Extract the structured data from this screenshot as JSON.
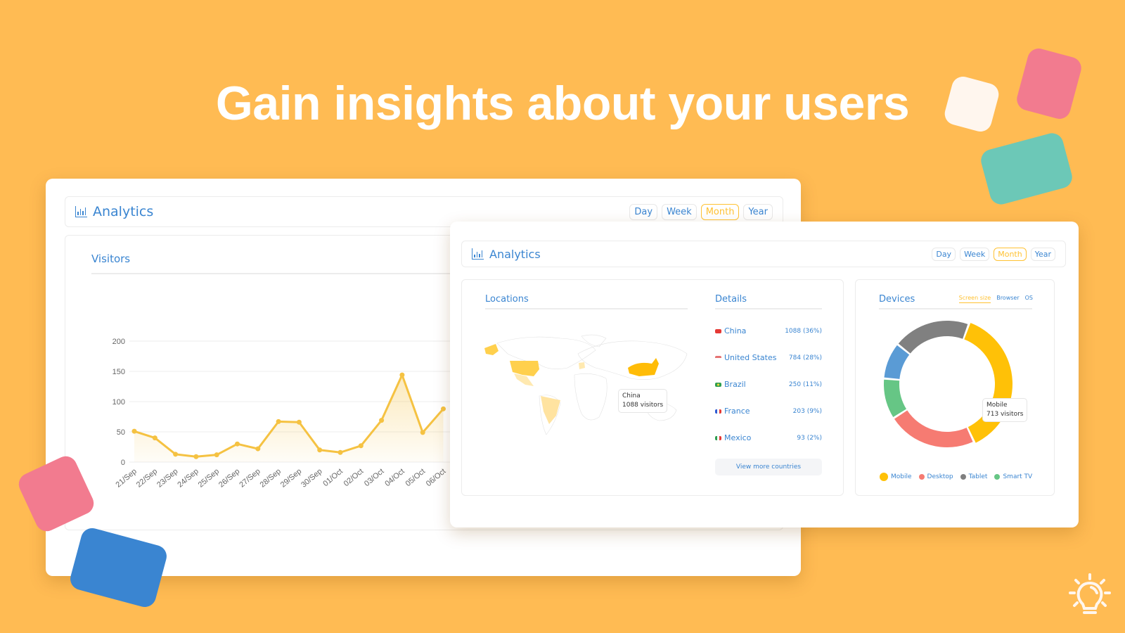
{
  "headline": "Gain insights about your users",
  "colors": {
    "background": "#FFBB53",
    "accent_blue": "#3A85D1",
    "accent_yellow": "#FFC233",
    "line_series": "#F5C242"
  },
  "back_window": {
    "title": "Analytics",
    "title_icon": "bar-chart-icon",
    "periods": [
      {
        "label": "Day",
        "active": false
      },
      {
        "label": "Week",
        "active": false
      },
      {
        "label": "Month",
        "active": true
      },
      {
        "label": "Year",
        "active": false
      }
    ],
    "panel_title": "Visitors"
  },
  "front_window": {
    "title": "Analytics",
    "title_icon": "bar-chart-icon",
    "periods": [
      {
        "label": "Day",
        "active": false
      },
      {
        "label": "Week",
        "active": false
      },
      {
        "label": "Month",
        "active": true
      },
      {
        "label": "Year",
        "active": false
      }
    ],
    "locations": {
      "title": "Locations",
      "map_tooltip": {
        "line1": "China",
        "line2": "1088 visitors"
      },
      "highlighted_countries": [
        "China",
        "United States",
        "Brazil",
        "France",
        "Mexico"
      ]
    },
    "details": {
      "title": "Details",
      "rows": [
        {
          "country": "China",
          "flag": "cn-flag-icon",
          "flag_color": "#E53935",
          "value": "1088 (36%)"
        },
        {
          "country": "United States",
          "flag": "us-flag-icon",
          "flag_color": "#E57373",
          "value": "784 (28%)"
        },
        {
          "country": "Brazil",
          "flag": "br-flag-icon",
          "flag_color": "#2E9E4F",
          "value": "250 (11%)"
        },
        {
          "country": "France",
          "flag": "fr-flag-icon",
          "flag_color": "#2F5BD3",
          "value": "203 (9%)"
        },
        {
          "country": "Mexico",
          "flag": "mx-flag-icon",
          "flag_color": "#2E9E4F",
          "value": "93 (2%)"
        }
      ],
      "view_more_label": "View more countries"
    },
    "devices": {
      "title": "Devices",
      "tabs": [
        {
          "label": "Screen size",
          "active": true
        },
        {
          "label": "Browser",
          "active": false
        },
        {
          "label": "OS",
          "active": false
        }
      ],
      "tooltip": {
        "line1": "Mobile",
        "line2": "713 visitors"
      },
      "legend": [
        {
          "label": "Mobile",
          "color": "#FFC107"
        },
        {
          "label": "Desktop",
          "color": "#F67B72"
        },
        {
          "label": "Tablet",
          "color": "#808080"
        },
        {
          "label": "Smart TV",
          "color": "#66C685"
        }
      ]
    }
  },
  "chart_data": [
    {
      "type": "area",
      "title": "Visitors",
      "xlabel": "",
      "ylabel": "",
      "ylim": [
        0,
        200
      ],
      "yticks": [
        0,
        50,
        100,
        150,
        200
      ],
      "grid": true,
      "categories": [
        "21/Sep",
        "22/Sep",
        "23/Sep",
        "24/Sep",
        "25/Sep",
        "26/Sep",
        "27/Sep",
        "28/Sep",
        "29/Sep",
        "30/Sep",
        "01/Oct",
        "02/Oct",
        "03/Oct",
        "04/Oct",
        "05/Oct",
        "06/Oct"
      ],
      "series": [
        {
          "name": "Visitors",
          "color": "#F5C242",
          "values": [
            51,
            40,
            13,
            9,
            12,
            30,
            22,
            67,
            66,
            20,
            16,
            27,
            69,
            144,
            49,
            88
          ]
        }
      ]
    },
    {
      "type": "pie",
      "title": "Devices",
      "donut": true,
      "categories": [
        "Mobile",
        "Desktop",
        "Smart TV",
        "Blue segment",
        "Tablet"
      ],
      "values": [
        36,
        22,
        10,
        9,
        19
      ],
      "colors": [
        "#FFC107",
        "#F67B72",
        "#66C685",
        "#5A9BD5",
        "#808080"
      ],
      "highlighted": {
        "label": "Mobile",
        "visitors": 713
      }
    }
  ]
}
